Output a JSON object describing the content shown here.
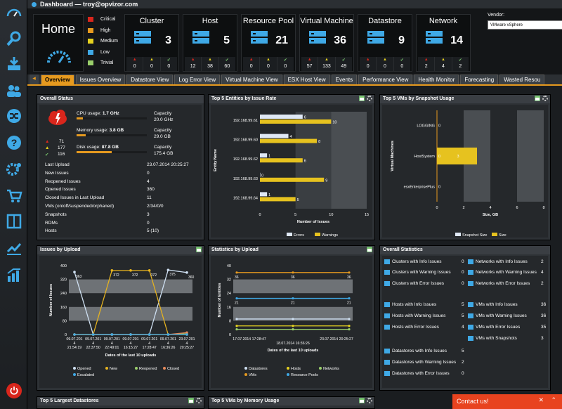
{
  "window": {
    "title": "Dashboard — troy@opvizor.com"
  },
  "home": {
    "title": "Home"
  },
  "severity": [
    "Critical",
    "High",
    "Medium",
    "Low",
    "Trivial"
  ],
  "cards": [
    {
      "name": "Cluster",
      "count": "3",
      "stats": [
        "0",
        "0",
        "0"
      ]
    },
    {
      "name": "Host",
      "count": "5",
      "stats": [
        "12",
        "38",
        "60"
      ]
    },
    {
      "name": "Resource Pool",
      "count": "21",
      "stats": [
        "0",
        "0",
        "0"
      ]
    },
    {
      "name": "Virtual Machine",
      "count": "36",
      "stats": [
        "57",
        "133",
        "49"
      ]
    },
    {
      "name": "Datastore",
      "count": "9",
      "stats": [
        "0",
        "0",
        "0"
      ]
    },
    {
      "name": "Network",
      "count": "14",
      "stats": [
        "2",
        "4",
        "2"
      ]
    }
  ],
  "vendor": {
    "label": "Vendor:",
    "selected": "VMware vSphere"
  },
  "tabs": [
    "Overview",
    "Issues Overview",
    "Datastore View",
    "Log Error View",
    "Virtual Machine View",
    "ESX Host View",
    "Events",
    "Performance View",
    "Health Monitor",
    "Forecasting",
    "Wasted Resou"
  ],
  "overall_status": {
    "title": "Overall Status",
    "cpu": {
      "label": "CPU usage:",
      "value": "1.7 GHz",
      "cap_label": "Capacity",
      "cap": "20.0 GHz",
      "fill": 0.085
    },
    "mem": {
      "label": "Memory usage:",
      "value": "3.8 GB",
      "cap_label": "Capacity",
      "cap": "29.0 GB",
      "fill": 0.13
    },
    "disk": {
      "label": "Disk usage:",
      "value": "87.8 GB",
      "cap_label": "Capacity",
      "cap": "175.4 GB",
      "fill": 0.5
    },
    "counts": [
      "71",
      "177",
      "116"
    ],
    "rows": [
      {
        "k": "Last Upload",
        "v": "23.07.2014 20:25:27"
      },
      {
        "k": "New Issues",
        "v": "0"
      },
      {
        "k": "Reopened Issues",
        "v": "4"
      },
      {
        "k": "Opened Issues",
        "v": "360"
      },
      {
        "k": "Closed Issues in Last Upload",
        "v": "11"
      },
      {
        "k": "VMs (on/off/suspended/orphaned)",
        "v": "2/34/0/0"
      },
      {
        "k": "Snapshots",
        "v": "3"
      },
      {
        "k": "RDMs",
        "v": "0"
      },
      {
        "k": "Hosts",
        "v": "5 (10)"
      }
    ]
  },
  "top5_issue": {
    "title": "Top 5 Entities by Issue Rate",
    "ylabel": "Entity Name",
    "xlabel": "Number of Issues",
    "legend": [
      "Errors",
      "Warnings"
    ]
  },
  "top5_snap": {
    "title": "Top 5 VMs by Snapshot Usage",
    "ylabel": "Virtual Machines",
    "xlabel": "Size, GB",
    "legend": [
      "Snapshot Size",
      "Size"
    ]
  },
  "issues_upload": {
    "title": "Issues by Upload",
    "ylabel": "Number of Issues",
    "xlabel": "Dates of the last 10 uploads",
    "legend": [
      "Opened",
      "New",
      "Reopened",
      "Closed",
      "Escalated"
    ]
  },
  "stats_upload": {
    "title": "Statistics by Upload",
    "ylabel": "Number of Entities",
    "xlabel": "Dates of the last 10 uploads",
    "legend": [
      "Datastores",
      "Hosts",
      "Networks",
      "VMs",
      "Resource Pools"
    ]
  },
  "overall_stats": {
    "title": "Overall Statistics",
    "left": [
      {
        "k": "Clusters with Info Issues",
        "v": "0"
      },
      {
        "k": "Clusters with Warning Issues",
        "v": "0"
      },
      {
        "k": "Clusters with Error Issues",
        "v": "0"
      },
      {
        "k": "Hosts with Info Issues",
        "v": "5"
      },
      {
        "k": "Hosts with Warning Issues",
        "v": "5"
      },
      {
        "k": "Hosts with Error Issues",
        "v": "4"
      },
      {
        "k": "Datastores with Info Issues",
        "v": "5"
      },
      {
        "k": "Datastores with Warning Issues",
        "v": "2"
      },
      {
        "k": "Datastores with Error Issues",
        "v": "0"
      }
    ],
    "right": [
      {
        "k": "Networks with Info Issues",
        "v": "2"
      },
      {
        "k": "Networks with Warning Issues",
        "v": "4"
      },
      {
        "k": "Networks with Error Issues",
        "v": "2"
      },
      {
        "k": "VMs with Info Issues",
        "v": "36"
      },
      {
        "k": "VMs with Warning Issues",
        "v": "36"
      },
      {
        "k": "VMs with Error Issues",
        "v": "35"
      },
      {
        "k": "VMs with Snapshots",
        "v": "3"
      }
    ]
  },
  "bottom": {
    "datastores": "Top 5 Largest Datastores",
    "memory": "Top 5 VMs by Memory Usage"
  },
  "contact": {
    "label": "Contact us!"
  },
  "colors": {
    "accent": "#e69a1f",
    "blue": "#3fa9e6"
  },
  "chart_data": [
    {
      "type": "bar",
      "title": "Top 5 Entities by Issue Rate",
      "categories": [
        "192.168.99.61",
        "192.168.99.60",
        "192.168.99.62",
        "192.168.99.63",
        "192.168.99.64"
      ],
      "series": [
        {
          "name": "Errors",
          "values": [
            6,
            4,
            1,
            0,
            1
          ]
        },
        {
          "name": "Warnings",
          "values": [
            10,
            8,
            6,
            9,
            5
          ]
        }
      ],
      "xlim": [
        0,
        15
      ],
      "xticks": [
        "0",
        "5",
        "10",
        "15"
      ],
      "xlabel": "Number of Issues",
      "ylabel": "Entity Name"
    },
    {
      "type": "bar",
      "title": "Top 5 VMs by Snapshot Usage",
      "categories": [
        "LOGGING",
        "HostSystem",
        "esxEnterprisePlus"
      ],
      "series": [
        {
          "name": "Snapshot Size",
          "values": [
            0,
            0,
            0
          ]
        },
        {
          "name": "Size",
          "values": [
            0,
            3,
            0
          ]
        }
      ],
      "xlim": [
        0,
        8
      ],
      "xticks": [
        "0",
        "2",
        "4",
        "6",
        "8"
      ],
      "xlabel": "Size, GB",
      "ylabel": "Virtual Machines"
    },
    {
      "type": "line",
      "title": "Issues by Upload",
      "categories": [
        "09.07.201 4 21:54:19",
        "09.07.201 4 22:37:50",
        "09.07.201 4 22:49:01",
        "09.07.201 4 16:15:27",
        "09.07.201 4 17:28:47",
        "09.07.201 4 16:36:26",
        "23.07.201 4 20:25:27"
      ],
      "ylim": [
        0,
        400
      ],
      "yticks": [
        "0",
        "80",
        "160",
        "240",
        "320",
        "400"
      ],
      "series": [
        {
          "name": "Opened",
          "values": [
            363,
            0,
            0,
            0,
            0,
            375,
            360
          ]
        },
        {
          "name": "New",
          "values": [
            0,
            0,
            372,
            372,
            372,
            0,
            0
          ]
        },
        {
          "name": "Reopened",
          "values": [
            0,
            0,
            0,
            0,
            0,
            0,
            4
          ]
        },
        {
          "name": "Closed",
          "values": [
            0,
            0,
            0,
            0,
            0,
            0,
            11
          ]
        },
        {
          "name": "Escalated",
          "values": [
            0,
            0,
            0,
            0,
            0,
            0,
            0
          ]
        }
      ],
      "labels": [
        "363",
        "372",
        "372",
        "372",
        "375",
        "360"
      ],
      "xlabel": "Dates of the last 10 uploads",
      "ylabel": "Number of Issues"
    },
    {
      "type": "line",
      "title": "Statistics by Upload",
      "categories": [
        "17.07.2014 17:28:47",
        "18.07.2014 16:36:26",
        "23.07.2014 20:25:27"
      ],
      "ylim": [
        0,
        40
      ],
      "yticks": [
        "0",
        "8",
        "16",
        "24",
        "32",
        "40"
      ],
      "series": [
        {
          "name": "VMs",
          "values": [
            36,
            36,
            36
          ]
        },
        {
          "name": "Resource Pools",
          "values": [
            21,
            21,
            21
          ]
        },
        {
          "name": "Datastores",
          "values": [
            9,
            9,
            9
          ]
        },
        {
          "name": "Hosts",
          "values": [
            5,
            5,
            5
          ]
        },
        {
          "name": "Networks",
          "values": [
            3,
            3,
            3
          ]
        }
      ],
      "xlabel": "Dates of the last 10 uploads",
      "ylabel": "Number of Entities"
    }
  ]
}
